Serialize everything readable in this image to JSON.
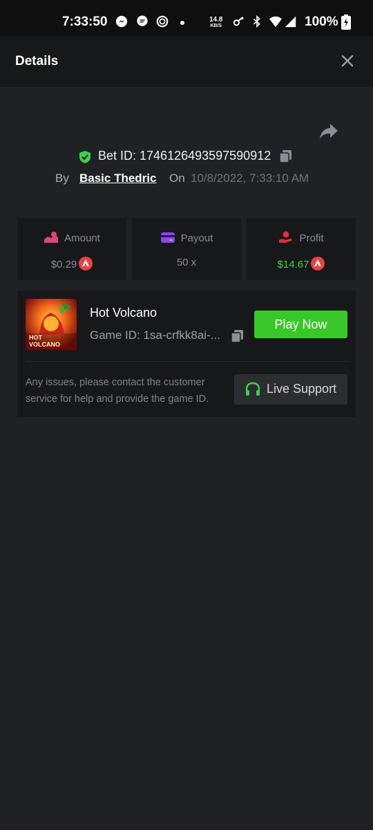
{
  "status_bar": {
    "time": "7:33:50",
    "speed_value": "14.8",
    "speed_unit": "KB/S",
    "battery": "100%"
  },
  "header": {
    "title": "Details"
  },
  "bet": {
    "id_text": "Bet ID: 1746126493597590912",
    "by_label": "By",
    "user": "Basic Thedric",
    "on_label": "On",
    "date": "10/8/2022, 7:33:10 AM"
  },
  "stats": {
    "amount": {
      "label": "Amount",
      "value": "$0.29"
    },
    "payout": {
      "label": "Payout",
      "value": "50 x"
    },
    "profit": {
      "label": "Profit",
      "value": "$14.67"
    }
  },
  "game": {
    "name": "Hot Volcano",
    "id_text": "Game ID: 1sa-crfkk8ai-...",
    "thumb_text_1": "HOT",
    "thumb_text_2": "VOLCANO",
    "play_label": "Play Now",
    "help_text": "Any issues, please contact the customer service for help and provide the game ID.",
    "support_label": "Live Support"
  },
  "colors": {
    "background": "#202124",
    "card": "#17181a",
    "accent_green": "#39c82a",
    "profit_green": "#3dd04b",
    "coin_red": "#e84142"
  },
  "icons": [
    "messenger-icon",
    "chat-icon",
    "ring-icon",
    "key-icon",
    "bluetooth-icon",
    "wifi-icon",
    "signal-icon",
    "battery-icon",
    "close-icon",
    "share-icon",
    "shield-check-icon",
    "copy-icon",
    "money-icon",
    "wallet-icon",
    "hand-coin-icon",
    "avax-coin-icon",
    "headset-icon"
  ]
}
